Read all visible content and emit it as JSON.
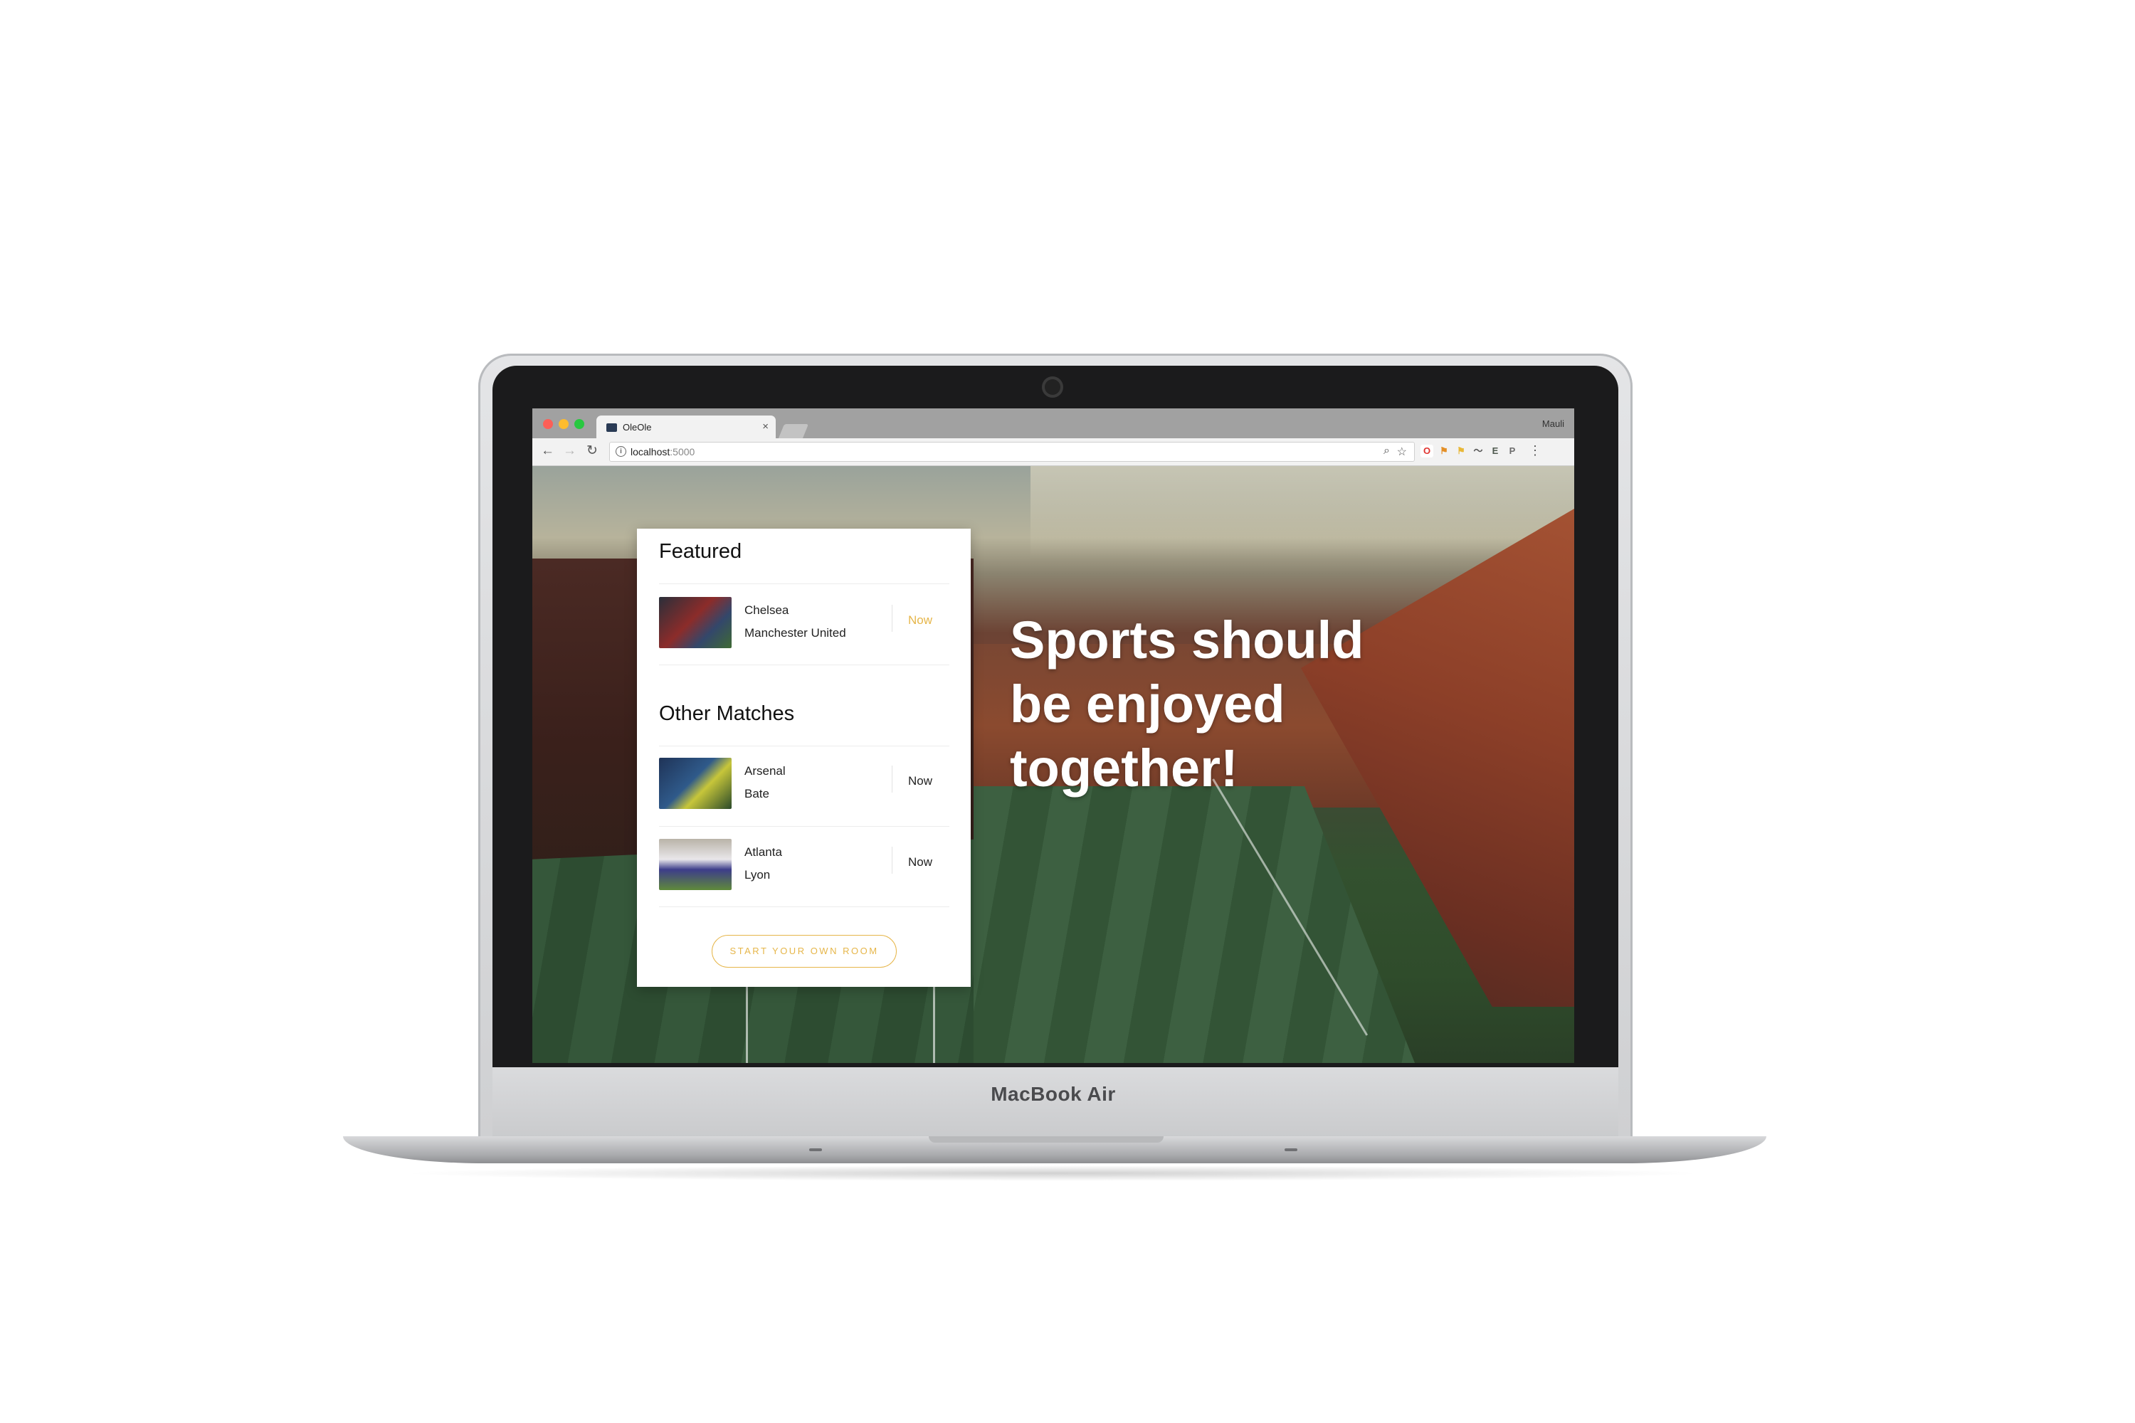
{
  "device": {
    "brand_label": "MacBook Air"
  },
  "browser": {
    "tab": {
      "title": "OleOle",
      "close_glyph": "×"
    },
    "profile_name": "Mauli",
    "address": {
      "host": "localhost",
      "port": ":5000"
    },
    "extensions": [
      {
        "icon": "opera-icon",
        "glyph": "O",
        "color": "#e0322e"
      },
      {
        "icon": "flag-icon",
        "glyph": "⚑",
        "color": "#e48f26"
      },
      {
        "icon": "bookmark-flag-icon",
        "glyph": "⚑",
        "color": "#e8b838"
      },
      {
        "icon": "wave-icon",
        "glyph": "〜",
        "color": "#5a5a5a"
      },
      {
        "icon": "evernote-icon",
        "glyph": "E",
        "color": "#4f5a4f"
      },
      {
        "icon": "paypal-icon",
        "glyph": "P",
        "color": "#6c6c6c"
      }
    ]
  },
  "featured": {
    "title": "Featured",
    "matches": [
      {
        "team_home": "Chelsea",
        "team_away": "Manchester United",
        "status": "Now"
      }
    ]
  },
  "other": {
    "title": "Other Matches",
    "matches": [
      {
        "team_home": "Arsenal",
        "team_away": "Bate",
        "status": "Now"
      },
      {
        "team_home": "Atlanta",
        "team_away": "Lyon",
        "status": "Now"
      }
    ]
  },
  "cta": {
    "label": "START YOUR OWN ROOM"
  },
  "hero": {
    "lines": [
      "Sports should",
      "be enjoyed",
      "together!"
    ]
  },
  "colors": {
    "accent": "#e6b64a"
  }
}
